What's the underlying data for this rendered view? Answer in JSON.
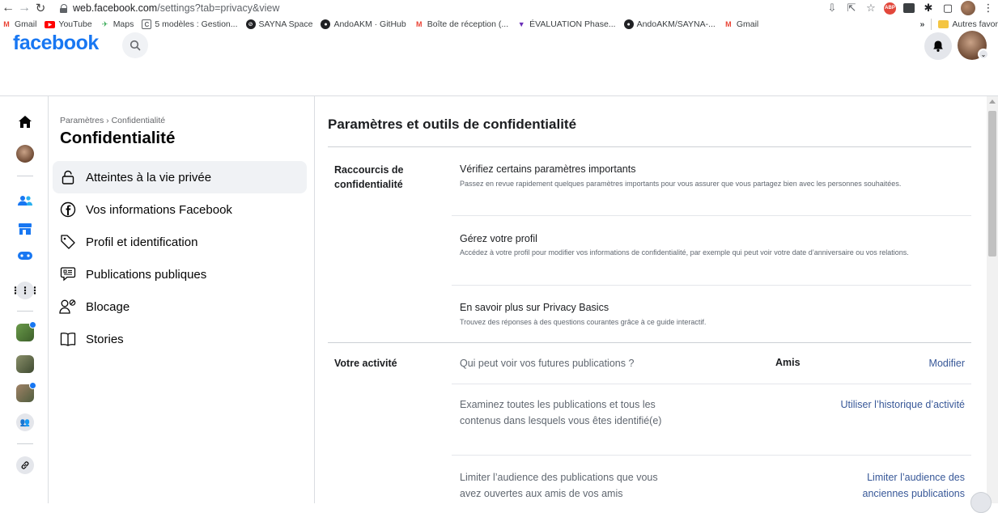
{
  "browser": {
    "url_host": "web.facebook.com",
    "url_path": "/settings?tab=privacy&view",
    "bookmarks": [
      {
        "label": "Gmail",
        "icon": "gmail-icon",
        "color": "#ea4335"
      },
      {
        "label": "YouTube",
        "icon": "youtube-icon",
        "color": "#ff0000"
      },
      {
        "label": "Maps",
        "icon": "maps-icon",
        "color": "#34a853"
      },
      {
        "label": "5 modèles : Gestion...",
        "icon": "page-icon",
        "color": "#5f6368"
      },
      {
        "label": "SAYNA Space",
        "icon": "sayna-icon",
        "color": "#202124"
      },
      {
        "label": "AndoAKM · GitHub",
        "icon": "github-icon",
        "color": "#202124"
      },
      {
        "label": "Boîte de réception (...",
        "icon": "gmail-icon",
        "color": "#ea4335"
      },
      {
        "label": "ÉVALUATION Phase...",
        "icon": "heart-icon",
        "color": "#6a2fb8"
      },
      {
        "label": "AndoAKM/SAYNA-...",
        "icon": "github-icon",
        "color": "#202124"
      },
      {
        "label": "Gmail",
        "icon": "gmail-icon",
        "color": "#ea4335"
      }
    ],
    "more_bookmarks": "»",
    "other_favorites": "Autres favor"
  },
  "header": {
    "logo": "facebook"
  },
  "settings_sidebar": {
    "breadcrumb": "Paramètres › Confidentialité",
    "title": "Confidentialité",
    "items": [
      {
        "label": "Atteintes à la vie privée",
        "icon": "lock-icon",
        "active": true
      },
      {
        "label": "Vos informations Facebook",
        "icon": "facebook-circle-icon",
        "active": false
      },
      {
        "label": "Profil et identification",
        "icon": "tag-icon",
        "active": false
      },
      {
        "label": "Publications publiques",
        "icon": "public-post-icon",
        "active": false
      },
      {
        "label": "Blocage",
        "icon": "block-user-icon",
        "active": false
      },
      {
        "label": "Stories",
        "icon": "book-icon",
        "active": false
      }
    ]
  },
  "main": {
    "title": "Paramètres et outils de confidentialité",
    "shortcuts": {
      "label": "Raccourcis de confidentialité",
      "items": [
        {
          "title": "Vérifiez certains paramètres importants",
          "desc": "Passez en revue rapidement quelques paramètres importants pour vous assurer que vous partagez bien avec les personnes souhaitées."
        },
        {
          "title": "Gérez votre profil",
          "desc": "Accédez à votre profil pour modifier vos informations de confidentialité, par exemple qui peut voir votre date d’anniversaire ou vos relations."
        },
        {
          "title": "En savoir plus sur Privacy Basics",
          "desc": "Trouvez des réponses à des questions courantes grâce à ce guide interactif."
        }
      ]
    },
    "activity": {
      "label": "Votre activité",
      "rows": [
        {
          "text": "Qui peut voir vos futures publications ?",
          "value": "Amis",
          "link": "Modifier"
        },
        {
          "text": "Examinez toutes les publications et tous les contenus dans lesquels vous êtes identifié(e)",
          "value": "",
          "link": "Utiliser l’historique d’activité"
        },
        {
          "text": "Limiter l’audience des publications que vous avez ouvertes aux amis de vos amis",
          "value": "",
          "link": "Limiter l’audience des anciennes publications"
        }
      ]
    }
  },
  "colors": {
    "fb_blue": "#1877f2",
    "link_blue": "#385898",
    "active_bg": "#f0f2f5",
    "notification_dot": "#1877f2"
  }
}
